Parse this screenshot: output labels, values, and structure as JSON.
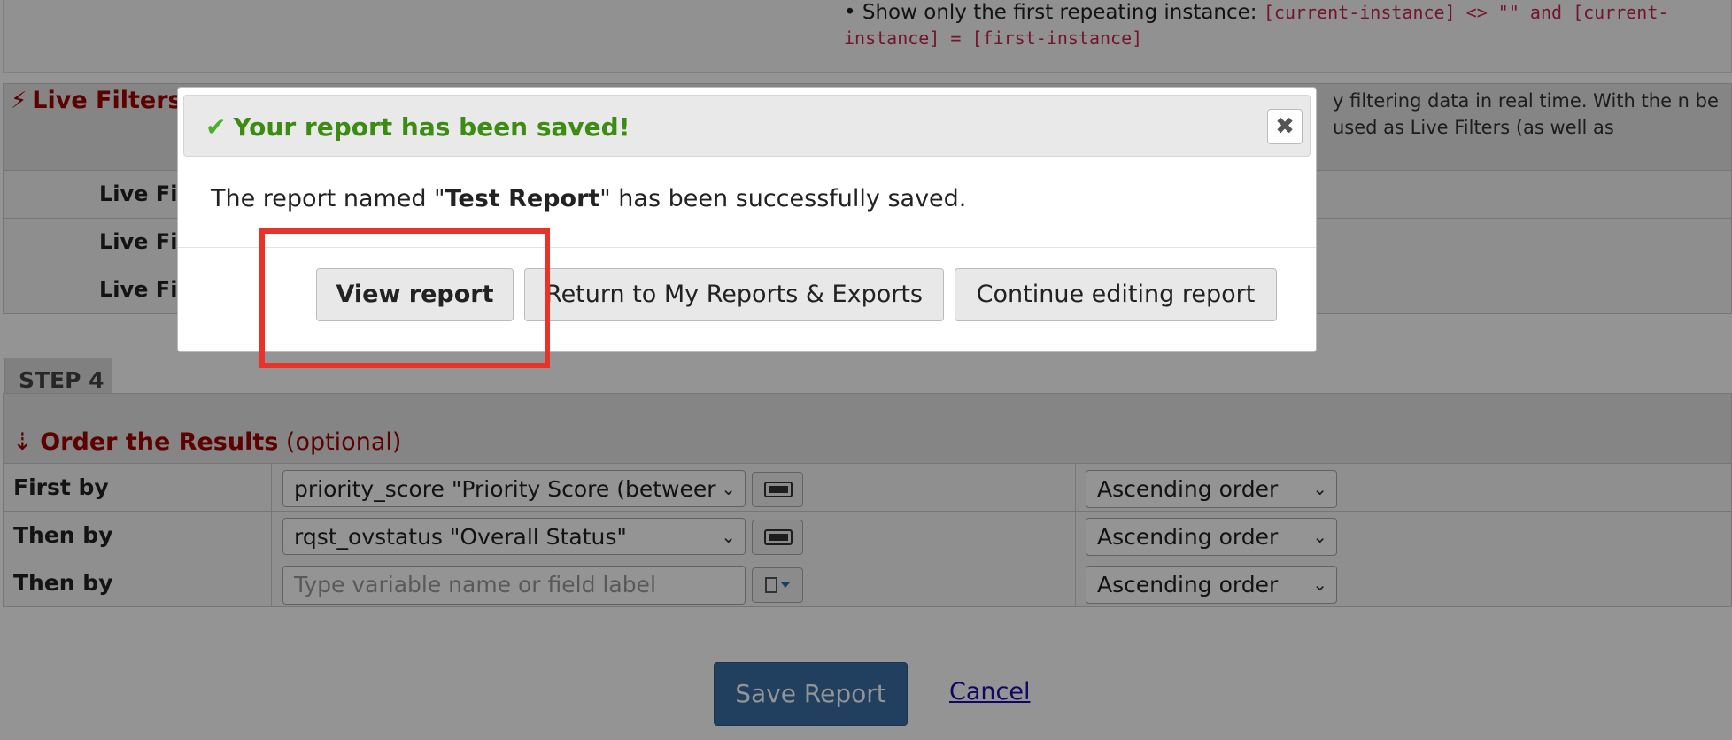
{
  "hint": {
    "bullet_text": "• Show only the first repeating instance:",
    "code": "[current-instance] <> \"\" and [current-instance] = [first-instance]"
  },
  "live_filters": {
    "title": "Live Filters",
    "description": "y filtering data in real time. With the n be used as Live Filters (as well as",
    "rows": [
      {
        "label": "Live Fil"
      },
      {
        "label": "Live Fil"
      },
      {
        "label": "Live Fil"
      }
    ]
  },
  "step4": {
    "tab_label": "STEP 4",
    "title": "Order the Results",
    "optional": "(optional)",
    "rows": [
      {
        "label": "First by",
        "field": "priority_score \"Priority Score (betweer",
        "order": "Ascending order"
      },
      {
        "label": "Then by",
        "field": "rqst_ovstatus \"Overall Status\"",
        "order": "Ascending order"
      },
      {
        "label": "Then by",
        "placeholder": "Type variable name or field label",
        "order": "Ascending order"
      }
    ]
  },
  "footer": {
    "save_label": "Save Report",
    "cancel_label": "Cancel"
  },
  "dialog": {
    "title": "Your report has been saved!",
    "close_symbol": "✖",
    "message_prefix": "The report named \"",
    "report_name": "Test Report",
    "message_suffix": "\" has been successfully saved.",
    "buttons": {
      "view": "View report",
      "return": "Return to My Reports & Exports",
      "continue": "Continue editing report"
    }
  },
  "colors": {
    "section_title": "#a00000",
    "success": "#3c8c14",
    "save_button": "#3a6ea5",
    "highlight": "#e8322a"
  }
}
